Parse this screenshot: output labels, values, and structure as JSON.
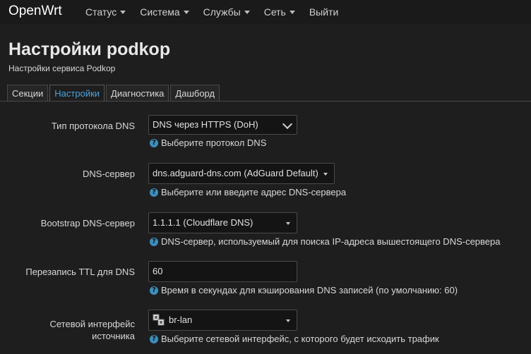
{
  "navbar": {
    "brand": "OpenWrt",
    "menu": [
      {
        "label": "Статус",
        "has_dropdown": true
      },
      {
        "label": "Система",
        "has_dropdown": true
      },
      {
        "label": "Службы",
        "has_dropdown": true
      },
      {
        "label": "Сеть",
        "has_dropdown": true
      },
      {
        "label": "Выйти",
        "has_dropdown": false
      }
    ]
  },
  "header": {
    "title": "Настройки podkop",
    "subtitle": "Настройки сервиса Podkop"
  },
  "tabs": [
    {
      "label": "Секции",
      "active": false
    },
    {
      "label": "Настройки",
      "active": true
    },
    {
      "label": "Диагностика",
      "active": false
    },
    {
      "label": "Дашборд",
      "active": false
    }
  ],
  "form": {
    "dns_protocol": {
      "label": "Тип протокола DNS",
      "value": "DNS через HTTPS (DoH)",
      "help": "Выберите протокол DNS"
    },
    "dns_server": {
      "label": "DNS-сервер",
      "value": "dns.adguard-dns.com (AdGuard Default)",
      "help": "Выберите или введите адрес DNS-сервера"
    },
    "bootstrap_dns": {
      "label": "Bootstrap DNS-сервер",
      "value": "1.1.1.1 (Cloudflare DNS)",
      "help": "DNS-сервер, используемый для поиска IP-адреса вышестоящего DNS-сервера"
    },
    "dns_ttl": {
      "label": "Перезапись TTL для DNS",
      "value": "60",
      "help": "Время в секундах для кэширования DNS записей (по умолчанию: 60)"
    },
    "source_iface": {
      "label_line1": "Сетевой интерфейс",
      "label_line2": "источника",
      "value": "br-lan",
      "help": "Выберите сетевой интерфейс, с которого будет исходить трафик"
    }
  },
  "icons": {
    "help": "help-icon",
    "interface": "network-interface-icon"
  },
  "colors": {
    "accent": "#4aa3df",
    "help_icon": "#3a8fbf",
    "background": "#1e1e1e"
  }
}
